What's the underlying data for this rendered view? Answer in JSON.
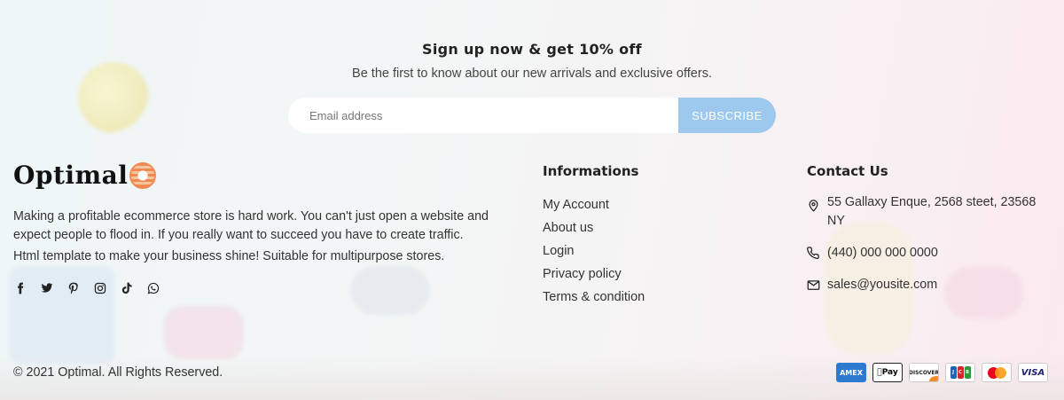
{
  "newsletter": {
    "title": "Sign up now & get 10% off",
    "subtitle": "Be the first to know about our new arrivals and exclusive offers.",
    "email_placeholder": "Email address",
    "button_label": "SUBSCRIBE"
  },
  "brand": {
    "name": "Optimal"
  },
  "about": {
    "text1": "Making a profitable ecommerce store is hard work. You can't just open a website and expect people to flood in. If you really want to succeed you have to create traffic.",
    "text2": "Html template to make your business shine! Suitable for multipurpose stores."
  },
  "social": [
    "facebook-icon",
    "twitter-icon",
    "pinterest-icon",
    "instagram-icon",
    "tiktok-icon",
    "whatsapp-icon"
  ],
  "informations": {
    "title": "Informations",
    "links": [
      {
        "label": "My Account"
      },
      {
        "label": "About us"
      },
      {
        "label": "Login"
      },
      {
        "label": "Privacy policy"
      },
      {
        "label": "Terms & condition"
      }
    ]
  },
  "contact": {
    "title": "Contact Us",
    "address": "55 Gallaxy Enque, 2568 steet, 23568 NY",
    "phone": "(440) 000 000 0000",
    "email": "sales@yousite.com"
  },
  "footer": {
    "copyright": "© 2021 Optimal. All Rights Reserved."
  },
  "payments": [
    {
      "icon": "amex-card-icon",
      "label": "AMEX"
    },
    {
      "icon": "apple-pay-icon",
      "label": "Pay"
    },
    {
      "icon": "discover-card-icon",
      "label": "DISCOVER"
    },
    {
      "icon": "jcb-card-icon",
      "label": "JCB"
    },
    {
      "icon": "mastercard-icon",
      "label": ""
    },
    {
      "icon": "visa-card-icon",
      "label": "VISA"
    }
  ],
  "colors": {
    "subscribe_button": "#9ec9ee",
    "brand_accent": "#f08a52"
  }
}
